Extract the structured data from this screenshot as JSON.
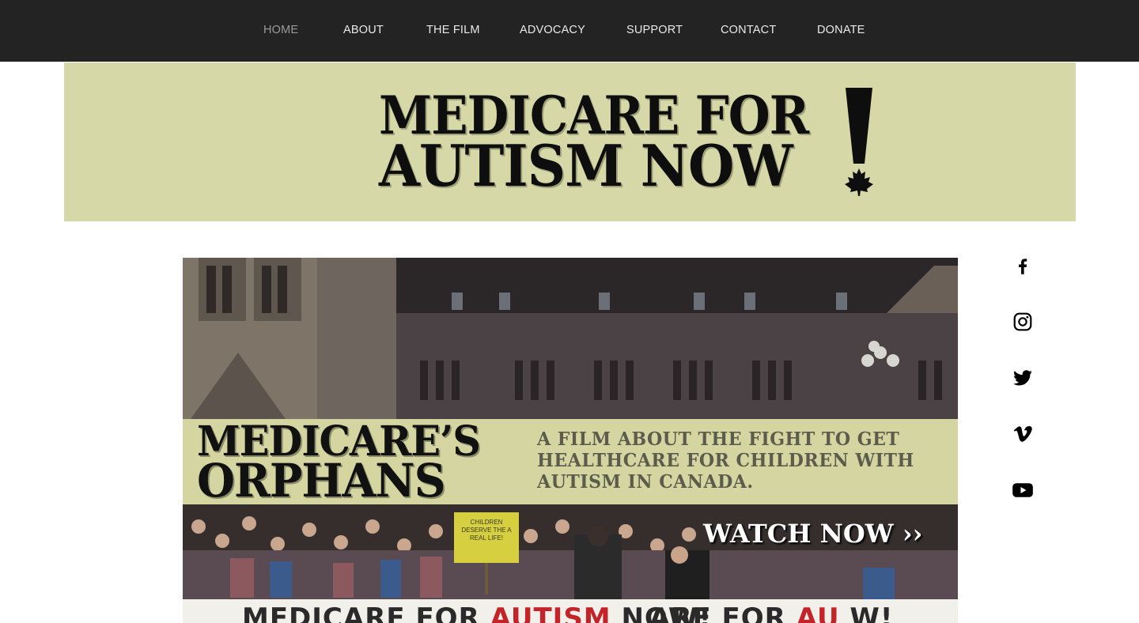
{
  "nav": {
    "items": [
      {
        "label": "HOME",
        "active": true
      },
      {
        "label": "ABOUT"
      },
      {
        "label": "THE FILM"
      },
      {
        "label": "ADVOCACY"
      },
      {
        "label": "SUPPORT"
      },
      {
        "label": "CONTACT"
      },
      {
        "label": "DONATE"
      }
    ]
  },
  "banner": {
    "logo_line1": "MEDICARE FOR",
    "logo_line2": "AUTISM NOW"
  },
  "hero": {
    "title_line1": "MEDICARE’S",
    "title_line2": "ORPHANS",
    "tagline": "A FILM ABOUT THE FIGHT TO GET HEALTHCARE FOR CHILDREN WITH AUTISM IN CANADA.",
    "cta": "WATCH NOW ››",
    "protest_banner_left_a": "MEDICARE FOR ",
    "protest_banner_left_b": "AUTISM",
    "protest_banner_left_c": " NOW!",
    "protest_banner_right_a": "ARE FOR ",
    "protest_banner_right_b": "AU",
    "protest_banner_right_c": "  W!",
    "sign_text": "CHILDREN DESERVE THE A REAL LIFE!"
  },
  "social": [
    {
      "icon": "facebook-icon"
    },
    {
      "icon": "instagram-icon"
    },
    {
      "icon": "twitter-icon"
    },
    {
      "icon": "vimeo-icon"
    },
    {
      "icon": "youtube-icon"
    }
  ],
  "colors": {
    "nav_bg": "#232323",
    "banner_bg": "#d7d8a7",
    "accent_red": "#c4232a"
  }
}
